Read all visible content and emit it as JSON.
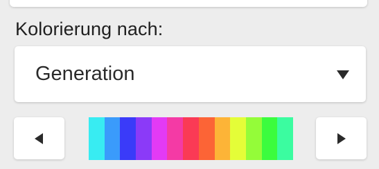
{
  "coloring": {
    "label": "Kolorierung nach:",
    "selected_option": "Generation"
  },
  "palette": {
    "colors": [
      "#38ecf2",
      "#3a9bfb",
      "#3a3bf9",
      "#8b3af8",
      "#e33af5",
      "#f43aa5",
      "#fa3a55",
      "#fc6436",
      "#fdb437",
      "#e4fd38",
      "#94fc39",
      "#3bfc3e",
      "#3bfca0"
    ]
  },
  "icons": {
    "dropdown": "caret-down-icon",
    "prev": "caret-left-icon",
    "next": "caret-right-icon"
  }
}
